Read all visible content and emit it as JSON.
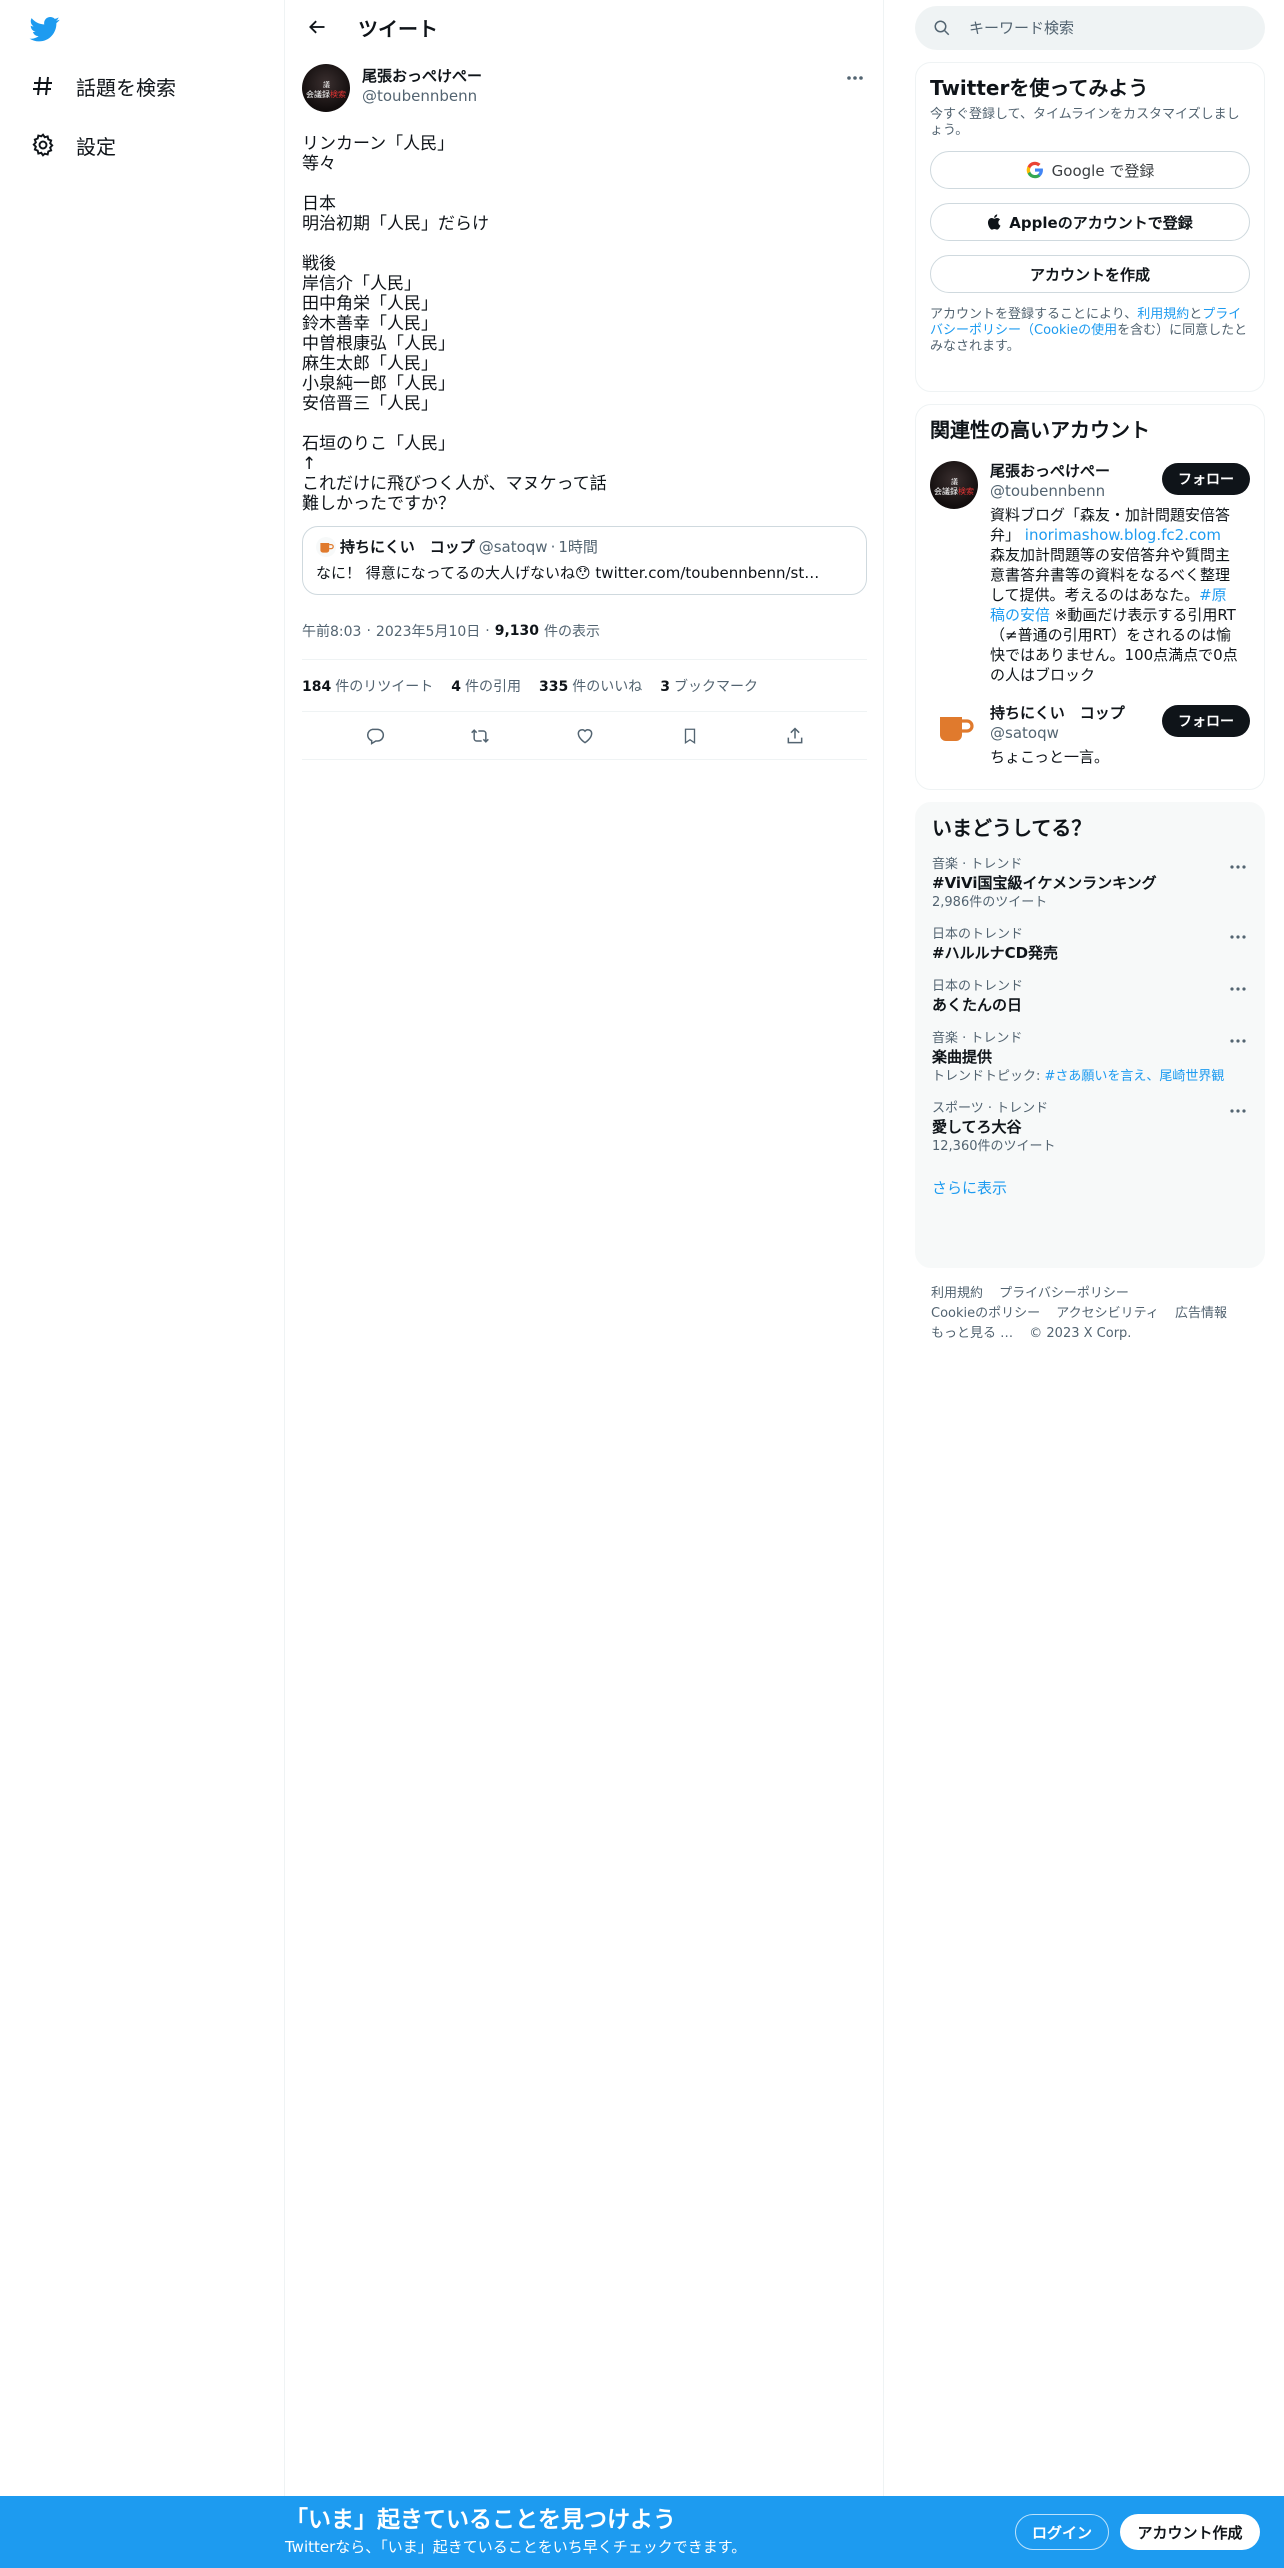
{
  "colors": {
    "brand": "#1d9bf0",
    "text": "#0f1419",
    "muted": "#536471",
    "follow_bg": "#0f1419"
  },
  "nav": {
    "logo_icon": "twitter-bird-icon",
    "items": [
      {
        "label": "話題を検索",
        "icon": "hashtag-icon"
      },
      {
        "label": "設定",
        "icon": "gear-icon"
      }
    ]
  },
  "header": {
    "title": "ツイート",
    "back_icon": "arrow-left-icon"
  },
  "tweet": {
    "author_name": "尾張おっぺけぺー",
    "author_handle": "@toubennbenn",
    "avatar_text_a": "議",
    "avatar_text_b1": "会議録",
    "avatar_text_b2": "検索",
    "text": "リンカーン「人民」\n等々\n\n日本\n明治初期「人民」だらけ\n\n戦後\n岸信介「人民」\n田中角栄「人民」\n鈴木善幸「人民」\n中曽根康弘「人民」\n麻生太郎「人民」\n小泉純一郎「人民」\n安倍晋三「人民」\n\n石垣のりこ「人民」\n↑\nこれだけに飛びつく人が、マヌケって話\n難しかったですか？",
    "quote": {
      "name": "持ちにくい　コップ",
      "handle": "@satoqw",
      "dot": "·",
      "time": "1時間",
      "text": "なに！ 得意になってるの大人げないね😯 twitter.com/toubennbenn/st…"
    },
    "time": "午前8:03",
    "date": "2023年5月10日",
    "meta_sep": "·",
    "views": "9,130",
    "views_label": "件の表示",
    "stats": [
      {
        "count": "184",
        "label": "件のリツイート"
      },
      {
        "count": "4",
        "label": "件の引用"
      },
      {
        "count": "335",
        "label": "件のいいね"
      },
      {
        "count": "3",
        "label": "ブックマーク"
      }
    ]
  },
  "search": {
    "placeholder": "キーワード検索"
  },
  "signup": {
    "title": "Twitterを使ってみよう",
    "desc": "今すぐ登録して、タイムラインをカスタマイズしましょう。",
    "google": "Google で登録",
    "apple": "Appleのアカウントで登録",
    "create": "アカウントを作成",
    "legal_pre": "アカウントを登録することにより、",
    "legal_terms": "利用規約",
    "legal_and": "と",
    "legal_privacy": "プライバシーポリシー（Cookieの使用",
    "legal_post": "を含む）に同意したとみなされます。"
  },
  "related": {
    "title": "関連性の高いアカウント",
    "follow_label": "フォロー",
    "accounts": [
      {
        "name": "尾張おっぺけぺー",
        "handle": "@toubennbenn",
        "bio_1": "資料ブログ「森友・加計問題安倍答弁」",
        "bio_link": "inorimashow.blog.fc2.com",
        "bio_2": " 森友加計問題等の安倍答弁や質問主意書答弁書等の資料をなるべく整理して提供。考えるのはあなた。",
        "bio_hashtag": "#原稿の安倍",
        "bio_3": " ※動画だけ表示する引用RT（≠普通の引用RT）をされるのは愉快ではありません。100点満点で0点の人はブロック"
      },
      {
        "name": "持ちにくい　コップ",
        "handle": "@satoqw",
        "bio_1": "ちょこっと一言。"
      }
    ]
  },
  "trends": {
    "title": "いまどうしてる？",
    "show_more": "さらに表示",
    "items": [
      {
        "context": "音楽 · トレンド",
        "name": "#ViVi国宝級イケメンランキング",
        "sub": "2,986件のツイート"
      },
      {
        "context": "日本のトレンド",
        "name": "#ハルルナCD発売",
        "sub": ""
      },
      {
        "context": "日本のトレンド",
        "name": "あくたんの日",
        "sub": ""
      },
      {
        "context": "音楽 · トレンド",
        "name": "楽曲提供",
        "sub_pre": "トレンドトピック: ",
        "sub_link": "#さあ願いを言え、尾崎世界観"
      },
      {
        "context": "スポーツ · トレンド",
        "name": "愛してろ大谷",
        "sub": "12,360件のツイート"
      }
    ]
  },
  "footer": {
    "links": [
      "利用規約",
      "プライバシーポリシー",
      "Cookieのポリシー",
      "アクセシビリティ",
      "広告情報",
      "もっと見る …",
      "© 2023 X Corp."
    ]
  },
  "banner": {
    "title": "「いま」起きていることを見つけよう",
    "sub": "Twitterなら、「いま」起きていることをいち早くチェックできます。",
    "login": "ログイン",
    "signup": "アカウント作成"
  }
}
